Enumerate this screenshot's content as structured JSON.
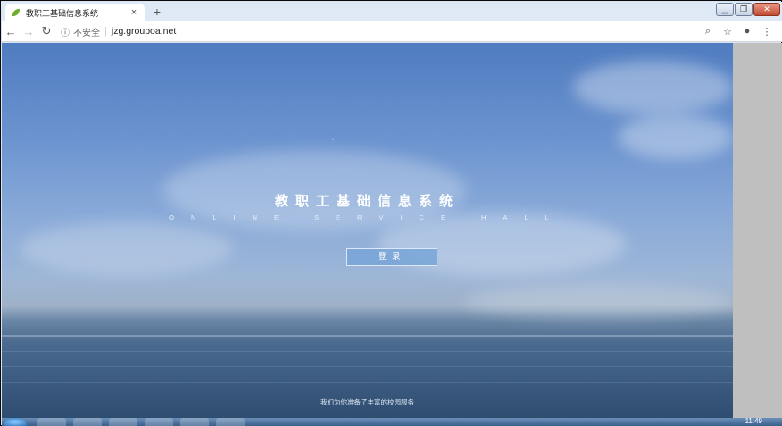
{
  "browser": {
    "tab_title": "教职工基础信息系统",
    "new_tab_symbol": "+",
    "tab_close_symbol": "×",
    "secure_label": "不安全",
    "url": "jzg.groupoa.net"
  },
  "hero": {
    "title": "教职工基础信息系统",
    "subtitle": "ONLINE SERVICE HALL",
    "login_label": "登录",
    "footer": "我们为你准备了丰富的校园服务"
  },
  "taskbar": {
    "clock": "11:49"
  },
  "colors": {
    "accent": "#78a5d7",
    "sky": "#6b93cf"
  }
}
